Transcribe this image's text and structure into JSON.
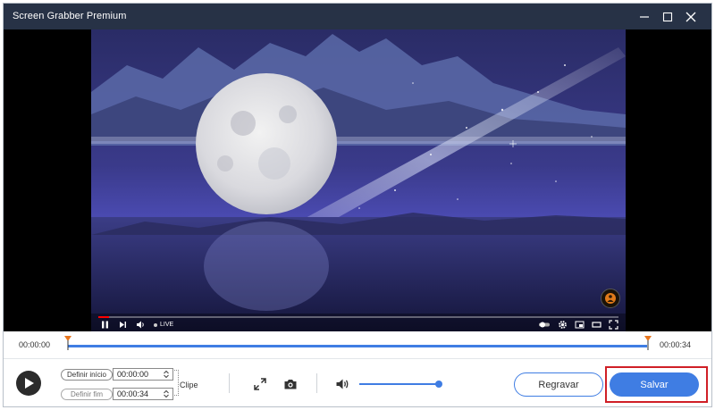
{
  "window": {
    "title": "Screen Grabber Premium",
    "controls": [
      "minimize-icon",
      "maximize-icon",
      "close-icon"
    ]
  },
  "player": {
    "overlay": {
      "live_label": "LIVE",
      "left_icons": [
        "pause-icon",
        "next-icon",
        "volume-icon"
      ],
      "right_icons": [
        "autoplay-toggle-icon",
        "settings-gear-icon",
        "miniplayer-icon",
        "theater-icon",
        "fullscreen-icon"
      ]
    },
    "progress_fraction": 0.02
  },
  "timeline": {
    "start": "00:00:00",
    "end": "00:00:34"
  },
  "controls": {
    "set_start_label": "Definir início",
    "set_start_value": "00:00:00",
    "set_end_label": "Definir fim",
    "set_end_value": "00:00:34",
    "clip_label": "Clipe",
    "volume_level": 1.0,
    "rerecord_label": "Regravar",
    "save_label": "Salvar"
  },
  "colors": {
    "titlebar": "#273246",
    "accent": "#3f7de3",
    "highlight": "#d01f26"
  }
}
